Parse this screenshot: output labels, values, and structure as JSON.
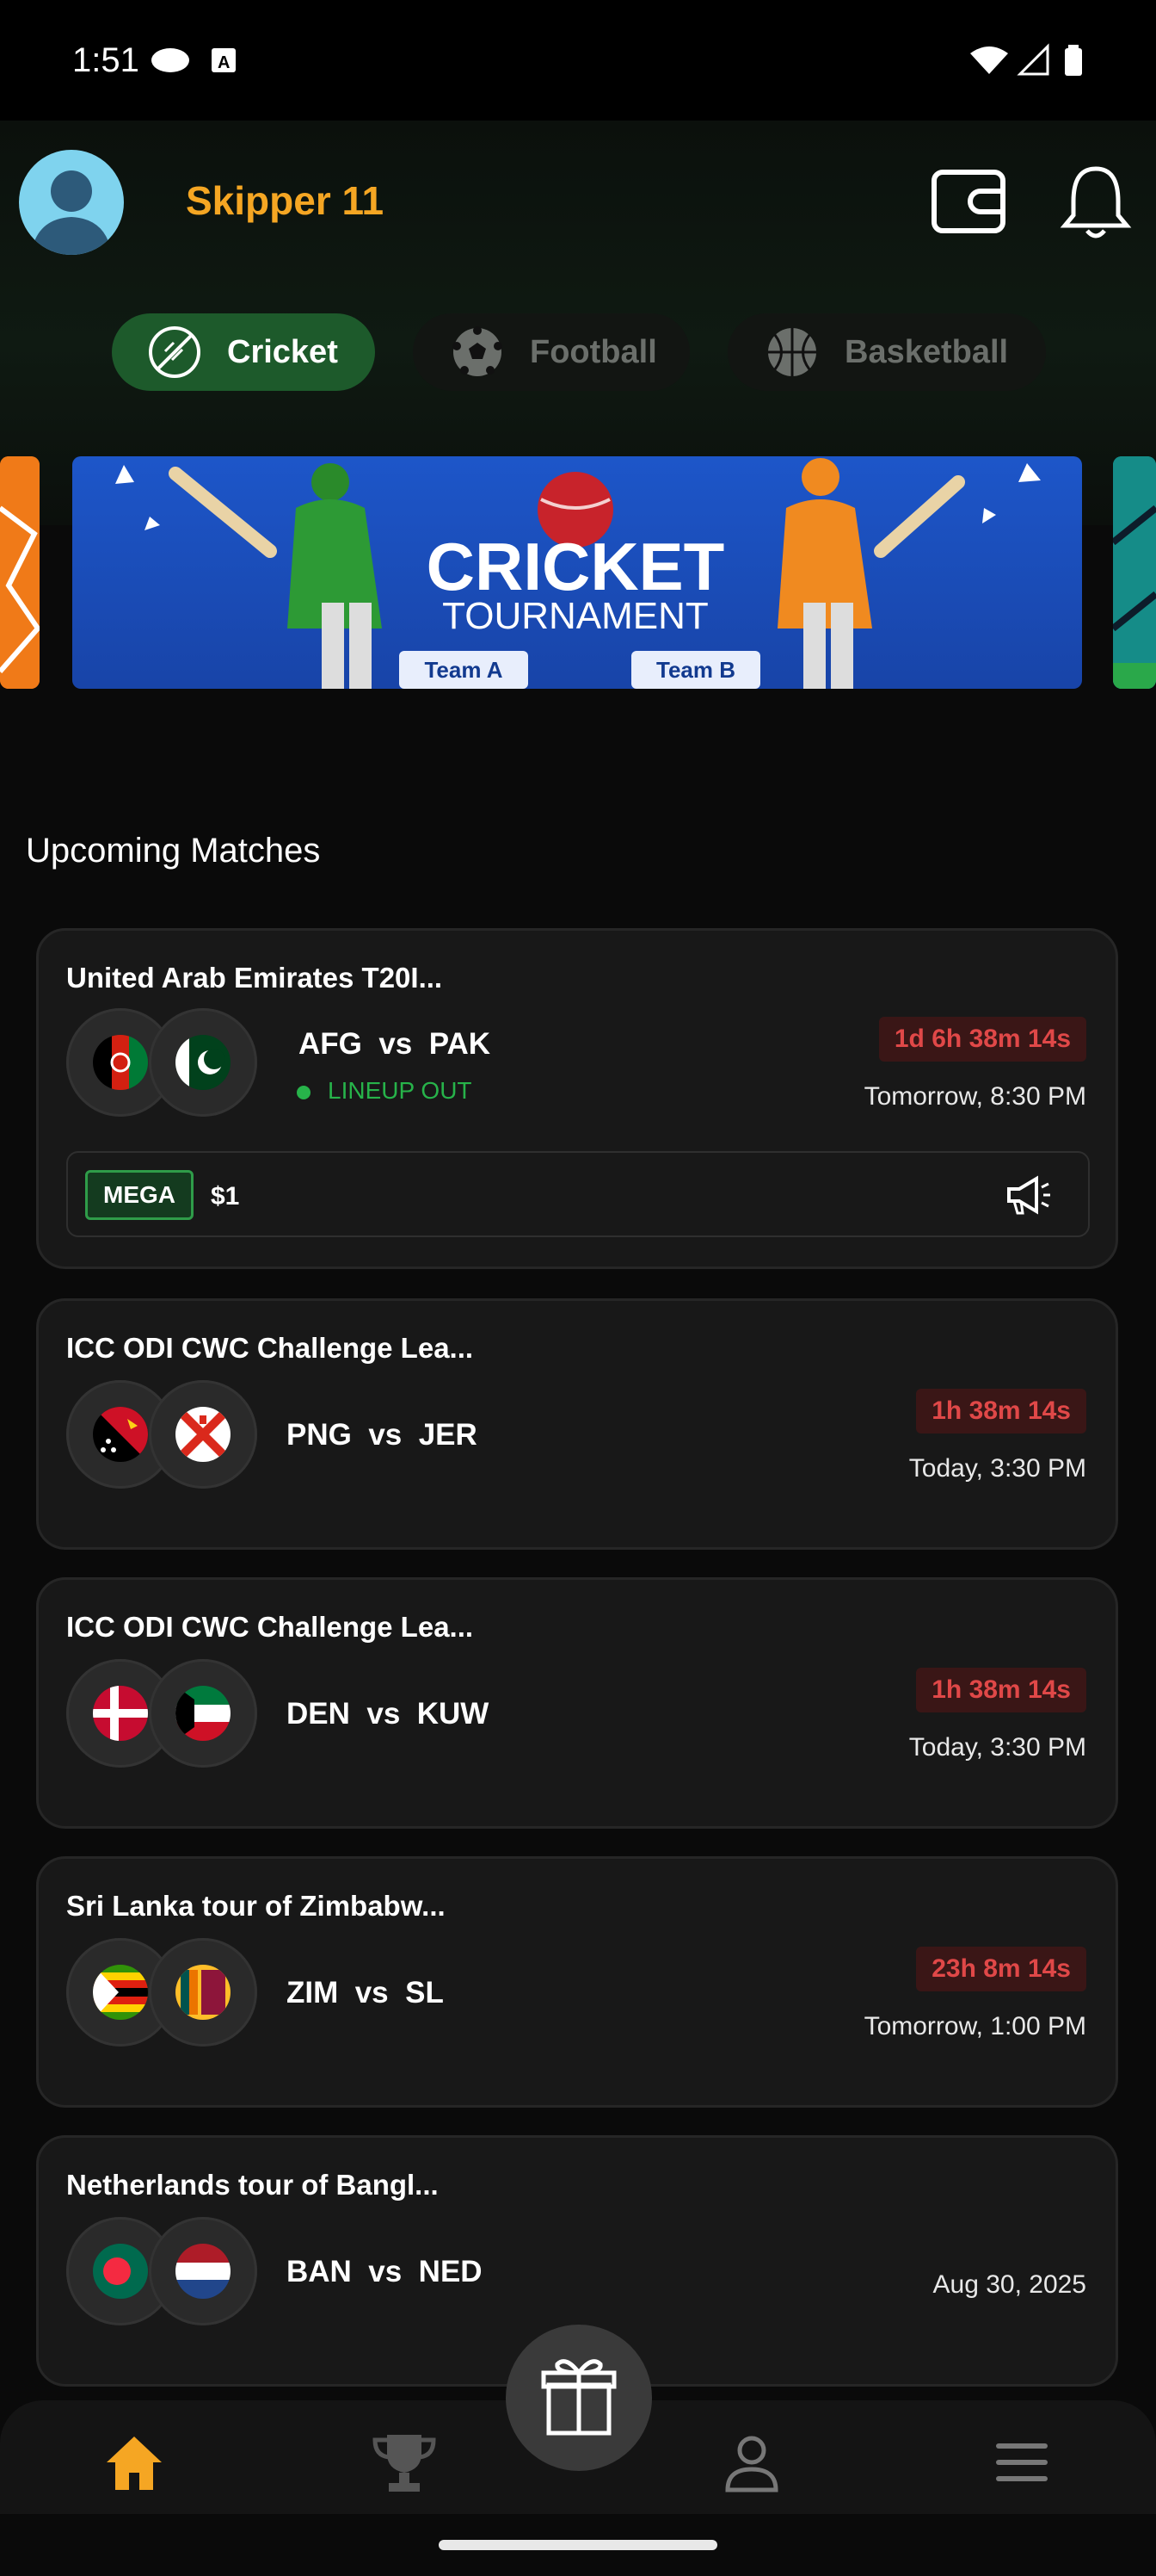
{
  "status": {
    "time": "1:51"
  },
  "header": {
    "app_title": "Skipper 11"
  },
  "tabs": [
    {
      "label": "Cricket",
      "icon": "cricket-ball-icon",
      "active": true
    },
    {
      "label": "Football",
      "icon": "football-icon",
      "active": false
    },
    {
      "label": "Basketball",
      "icon": "basketball-icon",
      "active": false
    }
  ],
  "banner": {
    "title": "CRICKET",
    "subtitle": "TOURNAMENT",
    "team_a": "Team A",
    "team_b": "Team B"
  },
  "section_title": "Upcoming Matches",
  "matches": [
    {
      "series": "United Arab Emirates T20I...",
      "team1": "AFG",
      "team2": "PAK",
      "vs": "vs",
      "countdown": "1d 6h 38m 14s",
      "when": "Tomorrow, 8:30 PM",
      "lineup": "LINEUP OUT",
      "contest": {
        "badge": "MEGA",
        "price": "$1"
      }
    },
    {
      "series": "ICC ODI CWC Challenge Lea...",
      "team1": "PNG",
      "team2": "JER",
      "vs": "vs",
      "countdown": "1h 38m 14s",
      "when": "Today, 3:30 PM"
    },
    {
      "series": "ICC ODI CWC Challenge Lea...",
      "team1": "DEN",
      "team2": "KUW",
      "vs": "vs",
      "countdown": "1h 38m 14s",
      "when": "Today, 3:30 PM"
    },
    {
      "series": "Sri Lanka tour of Zimbabw...",
      "team1": "ZIM",
      "team2": "SL",
      "vs": "vs",
      "countdown": "23h 8m 14s",
      "when": "Tomorrow, 1:00 PM"
    },
    {
      "series": "Netherlands tour of Bangl...",
      "team1": "BAN",
      "team2": "NED",
      "vs": "vs",
      "when": "Aug 30, 2025"
    }
  ],
  "bottom_nav": [
    {
      "name": "home",
      "icon": "home-icon",
      "active": true
    },
    {
      "name": "trophy",
      "icon": "trophy-icon",
      "active": false
    },
    {
      "name": "gift",
      "icon": "gift-icon",
      "active": false
    },
    {
      "name": "profile",
      "icon": "user-icon",
      "active": false
    },
    {
      "name": "menu",
      "icon": "menu-icon",
      "active": false
    }
  ],
  "colors": {
    "accent": "#f5a623",
    "active_tab": "#1d5a2b",
    "countdown": "#e04848",
    "lineup": "#27b34a"
  }
}
